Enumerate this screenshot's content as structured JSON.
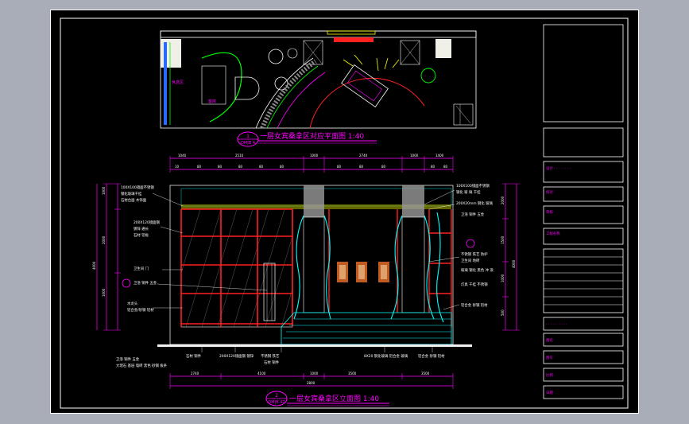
{
  "plan": {
    "title": "一层女宾桑拿区对应平面图 1:40",
    "tag": "DM|B 4",
    "tag_num": "1",
    "labels": [
      "休息区",
      "客房"
    ]
  },
  "elevation": {
    "title": "一层女宾桑拿区立面图 1:40",
    "tag": "DM|B 47",
    "tag_num": "2",
    "top_dims": [
      "1040",
      "2510",
      "1000",
      "2740",
      "1000",
      "1400",
      "10",
      "80",
      "80",
      "80",
      "80",
      "80",
      "80",
      "80",
      "80",
      "80",
      "80"
    ],
    "bottom_dims": [
      "2740",
      "4100",
      "3500",
      "1000",
      "3500",
      "2800"
    ],
    "left_dims": [
      "1000",
      "2000",
      "1000",
      "4000"
    ],
    "right_dims": [
      "2000",
      "1500",
      "1000",
      "500"
    ],
    "left_notes": [
      "100X100镜面不锈钢",
      "钢化玻璃干挂",
      "石材台面 木饰面",
      "200X120镜面钢",
      "镀锌 通长",
      "石材 铝板",
      "卫生间 门 ",
      "卫浴 铜件 五金",
      "水龙头",
      "铝合金/砂钢 铝材"
    ],
    "right_notes": [
      "100X100镜面不锈钢",
      "钢化 玻 璃 干挂",
      "200X20mm 钢化 玻璃",
      "卫浴 铜件 五金",
      "不锈钢 铁艺 防护",
      "卫生间 地砖",
      "玻璃 钢化 黑色 冲 浪",
      "灯具 干挂 不锈钢",
      "铝合金 砂钢 铝材"
    ],
    "bottom_notes": [
      "卫浴 铜件 五金 ",
      "大理石 基层 墙砖 黑色 砂钢 板条",
      "石材 铜件",
      "200X120镜面钢 镀锌",
      "不锈钢 铁艺",
      "石材 铜件",
      "8X20 钢化玻璃 铝合金 玻璃",
      "铝合金 砂钢 铝材"
    ]
  },
  "title_block": {
    "rows": [
      "设计 · · · · · · · ·",
      "校对",
      "审核",
      "工程名称",
      "· · · · · · · · · ·",
      "图名",
      "图号",
      "比例",
      "日期"
    ]
  },
  "colors": {
    "sheet": "#000000",
    "background": "#a8adb8",
    "magenta": "#ff00ff",
    "cyan": "#00ffff",
    "red": "#ff0000",
    "yellow": "#ffff00",
    "green": "#00ff00",
    "white": "#ffffff"
  }
}
